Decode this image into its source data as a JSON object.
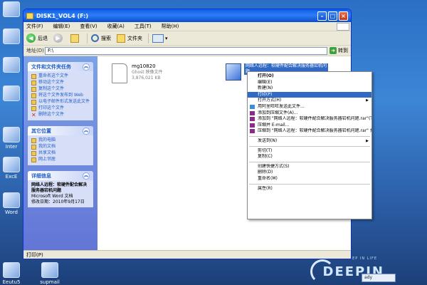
{
  "desktop": {
    "icons": [
      "Inter",
      "ExcE",
      "Word",
      "Eeutu5",
      "supmail"
    ],
    "brand": "DEEPIN",
    "brand_sub": "DEEP IN LIFE",
    "tray_text": "ady"
  },
  "window": {
    "title": "DISK1_VOL4 (F:)",
    "menu": [
      "文件(F)",
      "编辑(E)",
      "查看(V)",
      "收藏(A)",
      "工具(T)",
      "帮助(H)"
    ],
    "toolbar": {
      "back": "后退",
      "search": "搜索",
      "folders": "文件夹"
    },
    "address": {
      "label": "地址(D)",
      "value": "F:\\",
      "go": "转到"
    },
    "status": "打印(P)"
  },
  "taskpane": {
    "tasks_title": "文件和文件夹任务",
    "tasks": [
      "重命名这个文件",
      "移动这个文件",
      "复制这个文件",
      "将这个文件发布到 Web",
      "以电子邮件形式发送此文件",
      "打印这个文件",
      "删除这个文件"
    ],
    "places_title": "其它位置",
    "places": [
      "我的电脑",
      "我的文档",
      "共享文档",
      "网上邻居"
    ],
    "details_title": "详细信息",
    "details_name": "网络人远程：软硬件配合解决服务器宕机问题",
    "details_type": "Microsoft Word 文档",
    "details_date": "修改日期：2010年9月17日"
  },
  "files": [
    {
      "name": "mg10820",
      "type": "Ghost 映像文件",
      "size": "3,876,021 KB"
    },
    {
      "name": "网络人远程：软硬件配合解决服务器宕机问题"
    }
  ],
  "context_menu": [
    {
      "label": "打开(O)",
      "bold": true
    },
    {
      "label": "编辑(E)"
    },
    {
      "label": "新建(N)"
    },
    {
      "label": "打印(P)",
      "highlight": true
    },
    {
      "label": "打开方式(H)",
      "submenu": true
    },
    {
      "label": "用阿里旺旺发送此文件...",
      "icon": true
    },
    {
      "label": "添加到压缩文件(A)...",
      "icon": true
    },
    {
      "label": "添加到 \"网络人远程：软硬件配合解决服务器宕机问题.rar\"(T)",
      "icon": true
    },
    {
      "label": "压缩并 E-mail...",
      "icon": true
    },
    {
      "label": "压缩到 \"网络人远程：软硬件配合解决服务器宕机问题.rar\" 并 E-mail",
      "icon": true
    },
    {
      "sep": true
    },
    {
      "label": "发送到(N)",
      "submenu": true
    },
    {
      "sep": true
    },
    {
      "label": "剪切(T)"
    },
    {
      "label": "复制(C)"
    },
    {
      "sep": true
    },
    {
      "label": "创建快捷方式(S)"
    },
    {
      "label": "删除(D)"
    },
    {
      "label": "重命名(M)"
    },
    {
      "sep": true
    },
    {
      "label": "属性(R)"
    }
  ]
}
